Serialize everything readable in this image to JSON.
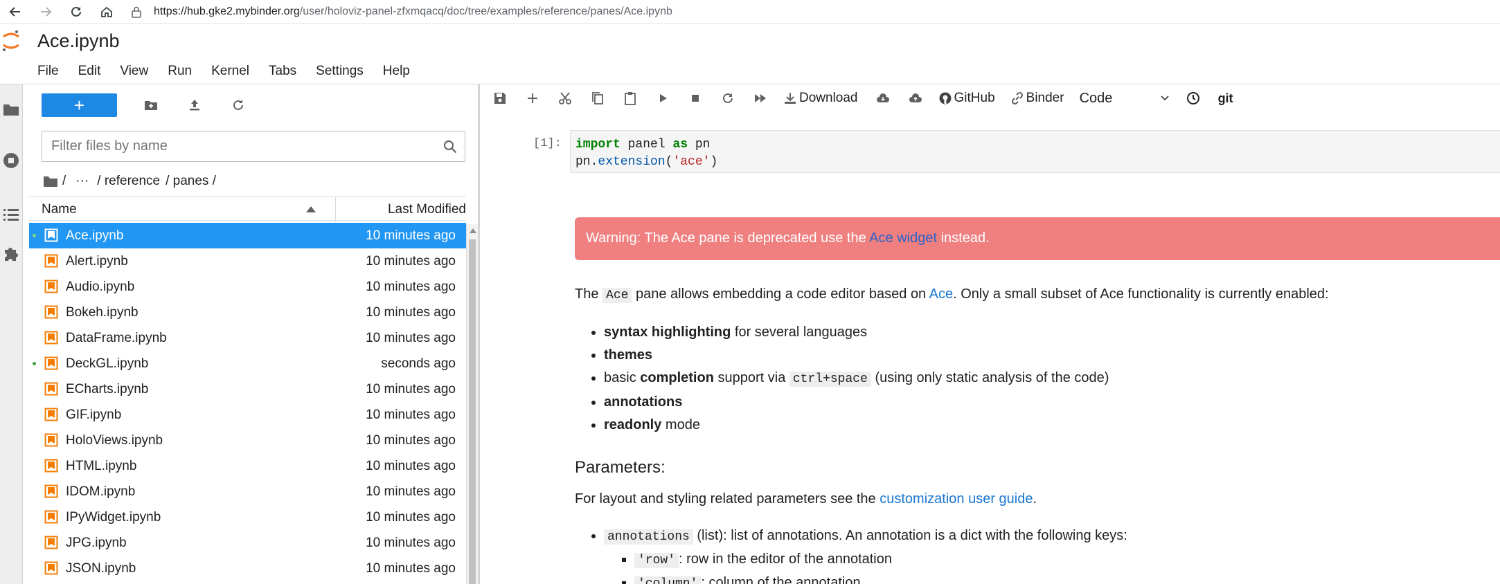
{
  "browser": {
    "url_host": "https://hub.gke2.mybinder.org",
    "url_path": "/user/holoviz-panel-zfxmqacq/doc/tree/examples/reference/panes/Ace.ipynb"
  },
  "app": {
    "title": "Ace.ipynb",
    "menu": [
      "File",
      "Edit",
      "View",
      "Run",
      "Kernel",
      "Tabs",
      "Settings",
      "Help"
    ]
  },
  "filebrowser": {
    "new_label": "+",
    "filter_placeholder": "Filter files by name",
    "breadcrumb": [
      "/",
      "···",
      "/ reference",
      "/ panes /"
    ],
    "col_name": "Name",
    "col_modified": "Last Modified",
    "files": [
      {
        "name": "Ace.ipynb",
        "modified": "10 minutes ago",
        "selected": true,
        "running": true
      },
      {
        "name": "Alert.ipynb",
        "modified": "10 minutes ago"
      },
      {
        "name": "Audio.ipynb",
        "modified": "10 minutes ago"
      },
      {
        "name": "Bokeh.ipynb",
        "modified": "10 minutes ago"
      },
      {
        "name": "DataFrame.ipynb",
        "modified": "10 minutes ago"
      },
      {
        "name": "DeckGL.ipynb",
        "modified": "seconds ago",
        "running": true
      },
      {
        "name": "ECharts.ipynb",
        "modified": "10 minutes ago"
      },
      {
        "name": "GIF.ipynb",
        "modified": "10 minutes ago"
      },
      {
        "name": "HoloViews.ipynb",
        "modified": "10 minutes ago"
      },
      {
        "name": "HTML.ipynb",
        "modified": "10 minutes ago"
      },
      {
        "name": "IDOM.ipynb",
        "modified": "10 minutes ago"
      },
      {
        "name": "IPyWidget.ipynb",
        "modified": "10 minutes ago"
      },
      {
        "name": "JPG.ipynb",
        "modified": "10 minutes ago"
      },
      {
        "name": "JSON.ipynb",
        "modified": "10 minutes ago"
      }
    ]
  },
  "notebook": {
    "toolbar": {
      "download": "Download",
      "github": "GitHub",
      "binder": "Binder",
      "cell_type": "Code",
      "git": "git"
    },
    "cell1": {
      "prompt": "[1]:",
      "line1_kw": "import",
      "line1_mid": " panel ",
      "line1_kw2": "as",
      "line1_end": " pn",
      "line2_obj": "pn.",
      "line2_fn": "extension",
      "line2_open": "(",
      "line2_str": "'ace'",
      "line2_close": ")"
    },
    "alert": {
      "pre": "Warning: The Ace pane is deprecated use the ",
      "link": "Ace widget",
      "post": " instead."
    },
    "intro": {
      "pre": "The ",
      "code": "Ace",
      "mid": " pane allows embedding a code editor based on ",
      "link": "Ace",
      "post": ". Only a small subset of Ace functionality is currently enabled:"
    },
    "features": {
      "f1_bold": "syntax highlighting",
      "f1_rest": " for several languages",
      "f2_bold": "themes",
      "f3_pre": "basic ",
      "f3_bold": "completion",
      "f3_mid": " support via ",
      "f3_code": "ctrl+space",
      "f3_rest": " (using only static analysis of the code)",
      "f4_bold": "annotations",
      "f5_bold": "readonly",
      "f5_rest": " mode"
    },
    "params_heading": "Parameters:",
    "params_intro": {
      "pre": "For layout and styling related parameters see the ",
      "link": "customization user guide",
      "post": "."
    },
    "param_annotations": {
      "code": "annotations",
      "rest": " (list): list of annotations. An annotation is a dict with the following keys:"
    },
    "sub_params": [
      {
        "code": "'row'",
        "rest": ": row in the editor of the annotation"
      },
      {
        "code": "'column'",
        "rest": ": column of the annotation"
      }
    ]
  }
}
